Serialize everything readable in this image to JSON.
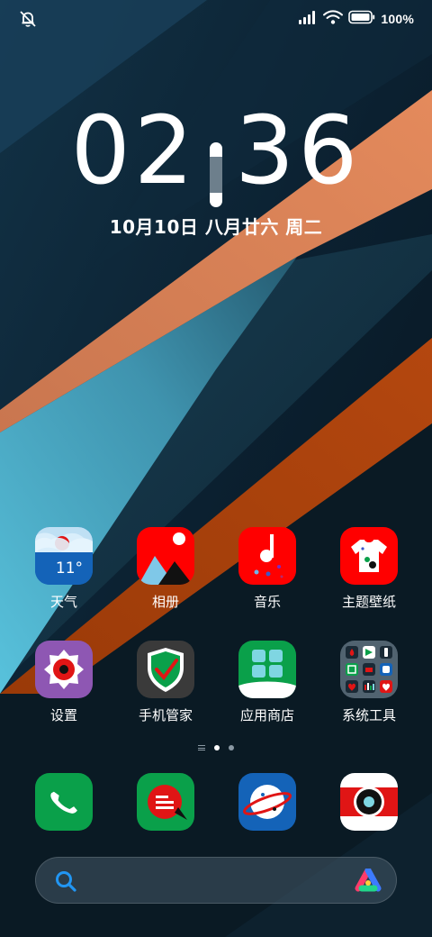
{
  "status_bar": {
    "left_icon": "notifications-muted-icon",
    "signal_icon": "signal-bars-icon",
    "wifi_icon": "wifi-icon",
    "battery_icon": "battery-full-icon",
    "battery_text": "100%"
  },
  "clock": {
    "hours": "02",
    "minutes": "36"
  },
  "date": "10月10日 八月廿六 周二",
  "apps_row1": [
    {
      "label": "天气",
      "icon": "weather-icon",
      "badge_text": "11°"
    },
    {
      "label": "相册",
      "icon": "gallery-icon"
    },
    {
      "label": "音乐",
      "icon": "music-icon"
    },
    {
      "label": "主题壁纸",
      "icon": "themes-icon"
    }
  ],
  "apps_row2": [
    {
      "label": "设置",
      "icon": "settings-icon"
    },
    {
      "label": "手机管家",
      "icon": "phone-manager-icon"
    },
    {
      "label": "应用商店",
      "icon": "app-store-icon"
    },
    {
      "label": "系统工具",
      "icon": "system-tools-folder-icon"
    }
  ],
  "dock": [
    {
      "icon": "phone-icon"
    },
    {
      "icon": "messages-icon"
    },
    {
      "icon": "browser-icon"
    },
    {
      "icon": "camera-icon"
    }
  ],
  "pager": {
    "pages": 2,
    "active_index": 0
  },
  "search_bar": {
    "search_icon": "search-icon",
    "assistant_icon": "assistant-icon"
  },
  "colors": {
    "wallpaper_dark": "#0c2130",
    "wallpaper_orange": "#d8825a",
    "wallpaper_rust": "#a8410d",
    "wallpaper_teal": "#3e8fa8",
    "accent_red": "#ff0000",
    "accent_green": "#0aa04a"
  }
}
